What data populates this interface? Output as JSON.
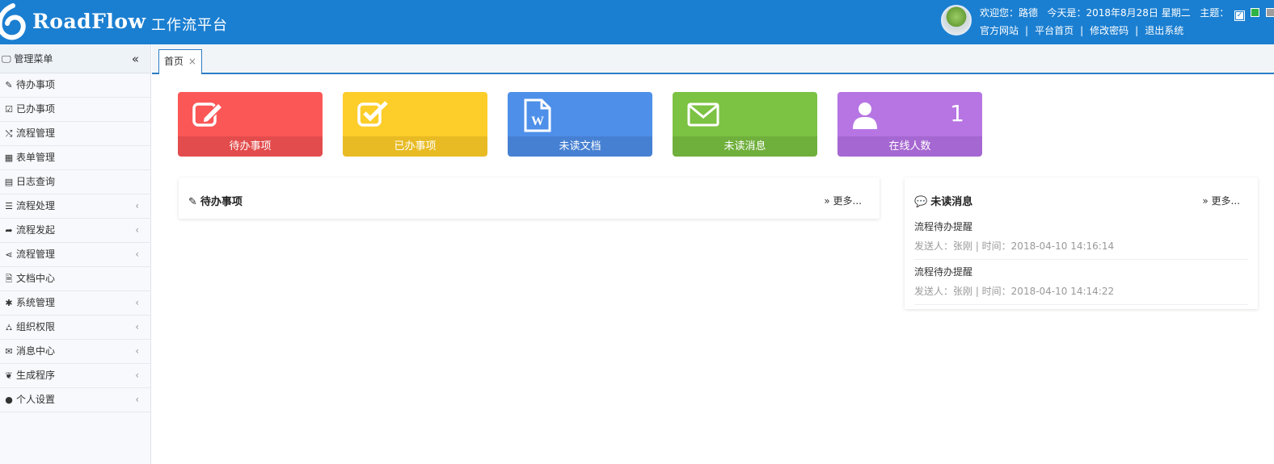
{
  "header": {
    "brand": "RoadFlow",
    "subtitle": "工作流平台",
    "welcome": "欢迎您：路德",
    "today": "今天是：2018年8月28日 星期二",
    "theme_label": "主题：",
    "links": [
      "官方网站",
      "平台首页",
      "修改密码",
      "退出系统"
    ],
    "link_sep": "|"
  },
  "sidebar": {
    "title": "管理菜单",
    "collapse": "«",
    "items": [
      {
        "label": "待办事项",
        "icon": "✎",
        "arrow": ""
      },
      {
        "label": "已办事项",
        "icon": "☑",
        "arrow": ""
      },
      {
        "label": "流程管理",
        "icon": "⤭",
        "arrow": ""
      },
      {
        "label": "表单管理",
        "icon": "▦",
        "arrow": ""
      },
      {
        "label": "日志查询",
        "icon": "▤",
        "arrow": ""
      },
      {
        "label": "流程处理",
        "icon": "☰",
        "arrow": "‹"
      },
      {
        "label": "流程发起",
        "icon": "➦",
        "arrow": "‹"
      },
      {
        "label": "流程管理",
        "icon": "⋖",
        "arrow": "‹"
      },
      {
        "label": "文档中心",
        "icon": "🗎",
        "arrow": ""
      },
      {
        "label": "系统管理",
        "icon": "✱",
        "arrow": "‹"
      },
      {
        "label": "组织权限",
        "icon": "⛼",
        "arrow": "‹"
      },
      {
        "label": "消息中心",
        "icon": "✉",
        "arrow": "‹"
      },
      {
        "label": "生成程序",
        "icon": "❦",
        "arrow": "‹"
      },
      {
        "label": "个人设置",
        "icon": "●",
        "arrow": "‹"
      }
    ]
  },
  "tabs": [
    {
      "label": "首页",
      "close": "×"
    }
  ],
  "cards": [
    {
      "label": "待办事项",
      "icon": "edit-icon",
      "count": ""
    },
    {
      "label": "已办事项",
      "icon": "check-square-icon",
      "count": ""
    },
    {
      "label": "未读文档",
      "icon": "word-doc-icon",
      "count": ""
    },
    {
      "label": "未读消息",
      "icon": "envelope-icon",
      "count": ""
    },
    {
      "label": "在线人数",
      "icon": "user-icon",
      "count": "1"
    }
  ],
  "todo_panel": {
    "title": "待办事项",
    "more": "» 更多..."
  },
  "msg_panel": {
    "title": "未读消息",
    "more": "» 更多...",
    "messages": [
      {
        "title": "流程待办提醒",
        "meta": "发送人：张刚 | 时间：2018-04-10 14:16:14"
      },
      {
        "title": "流程待办提醒",
        "meta": "发送人：张刚 | 时间：2018-04-10 14:14:22"
      }
    ]
  },
  "colors": {
    "header": "#1b7fd1",
    "red": "#fb5757",
    "yellow": "#fdcd2a",
    "blue": "#4e8fe9",
    "green": "#7cc243",
    "purple": "#b675e3"
  }
}
